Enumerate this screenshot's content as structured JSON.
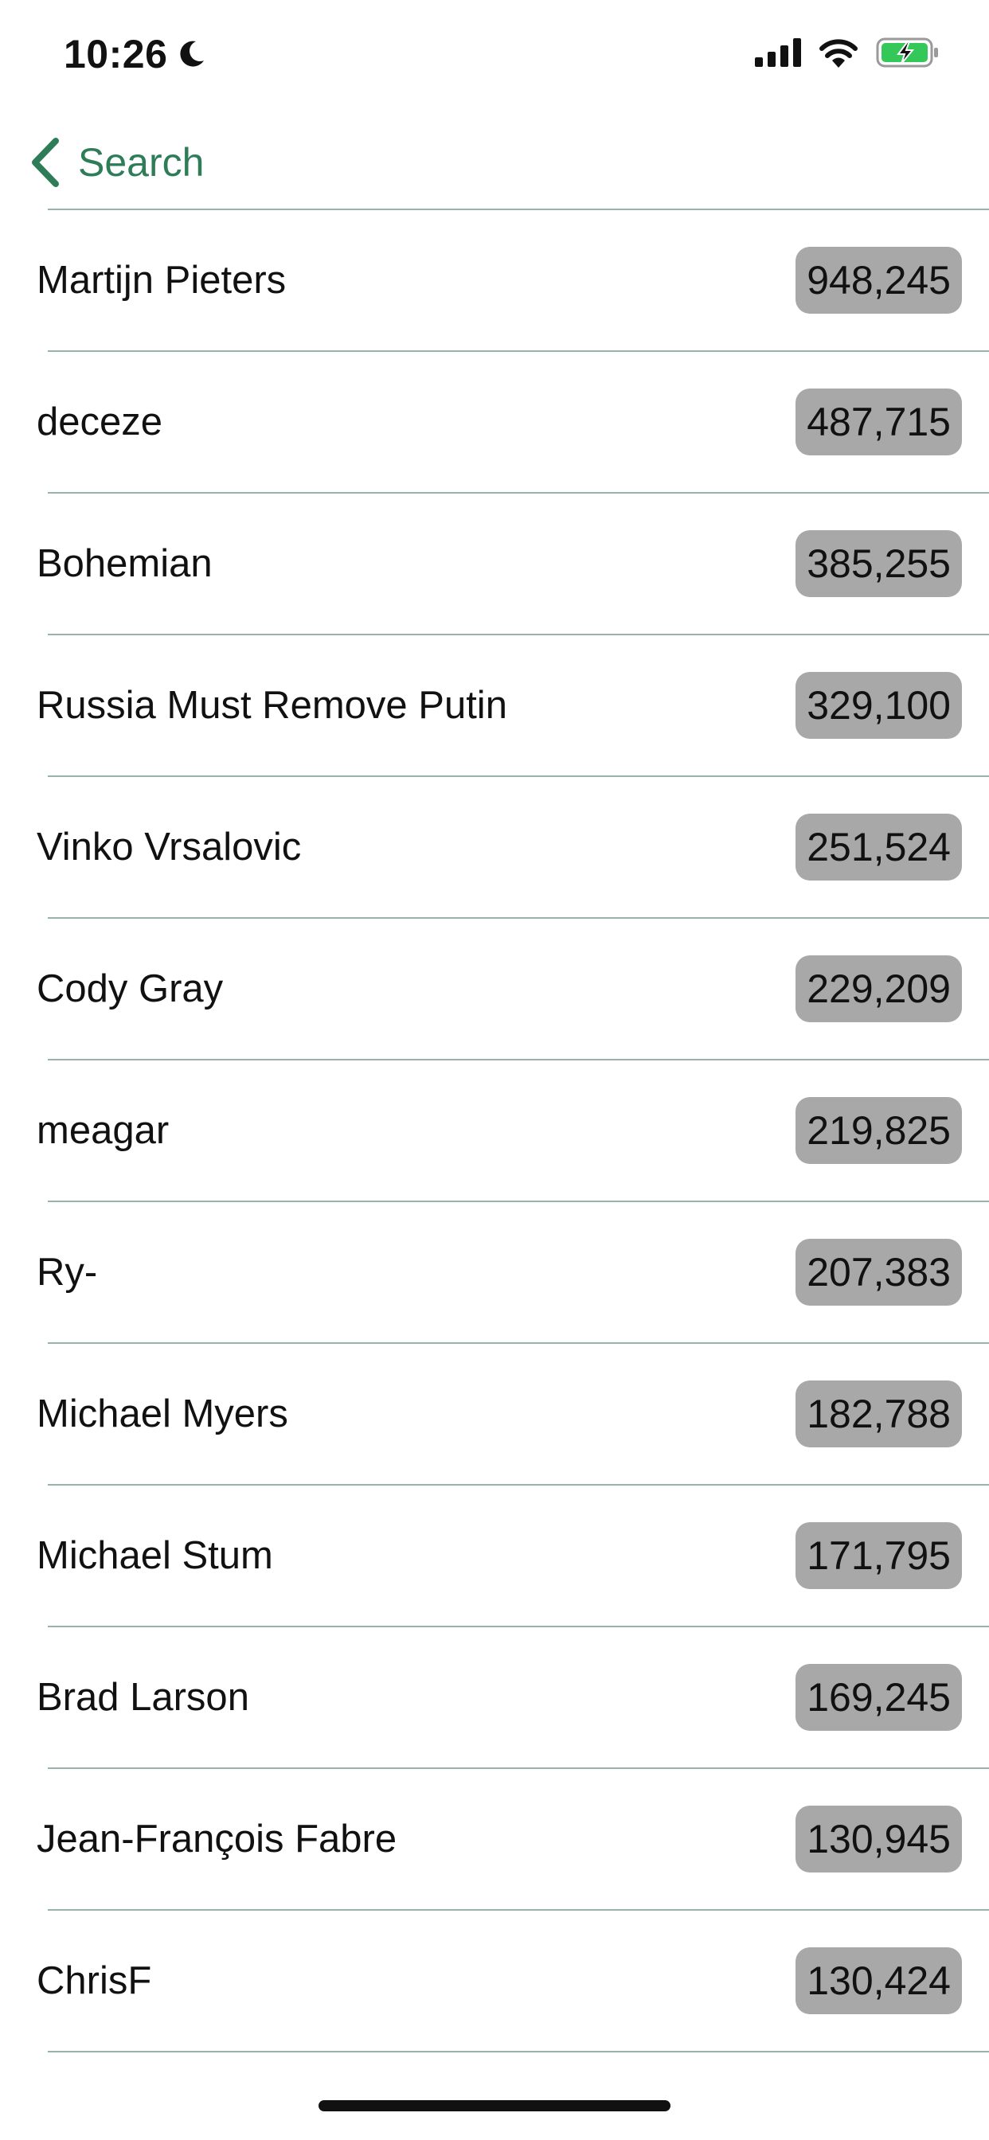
{
  "status_bar": {
    "time": "10:26",
    "icons": [
      "moon-icon",
      "signal-icon",
      "wifi-icon",
      "battery-charging-icon"
    ],
    "battery_color": "#34c759"
  },
  "nav": {
    "back_label": "Search",
    "accent_color": "#2e7d58"
  },
  "users": [
    {
      "name": "Martijn Pieters",
      "reputation": "948,245"
    },
    {
      "name": "deceze",
      "reputation": "487,715"
    },
    {
      "name": "Bohemian",
      "reputation": "385,255"
    },
    {
      "name": "Russia Must Remove Putin",
      "reputation": "329,100"
    },
    {
      "name": "Vinko Vrsalovic",
      "reputation": "251,524"
    },
    {
      "name": "Cody Gray",
      "reputation": "229,209"
    },
    {
      "name": "meagar",
      "reputation": "219,825"
    },
    {
      "name": "Ry-",
      "reputation": "207,383"
    },
    {
      "name": "Michael Myers",
      "reputation": "182,788"
    },
    {
      "name": "Michael Stum",
      "reputation": "171,795"
    },
    {
      "name": "Brad Larson",
      "reputation": "169,245"
    },
    {
      "name": "Jean-François Fabre",
      "reputation": "130,945"
    },
    {
      "name": "ChrisF",
      "reputation": "130,424"
    }
  ]
}
